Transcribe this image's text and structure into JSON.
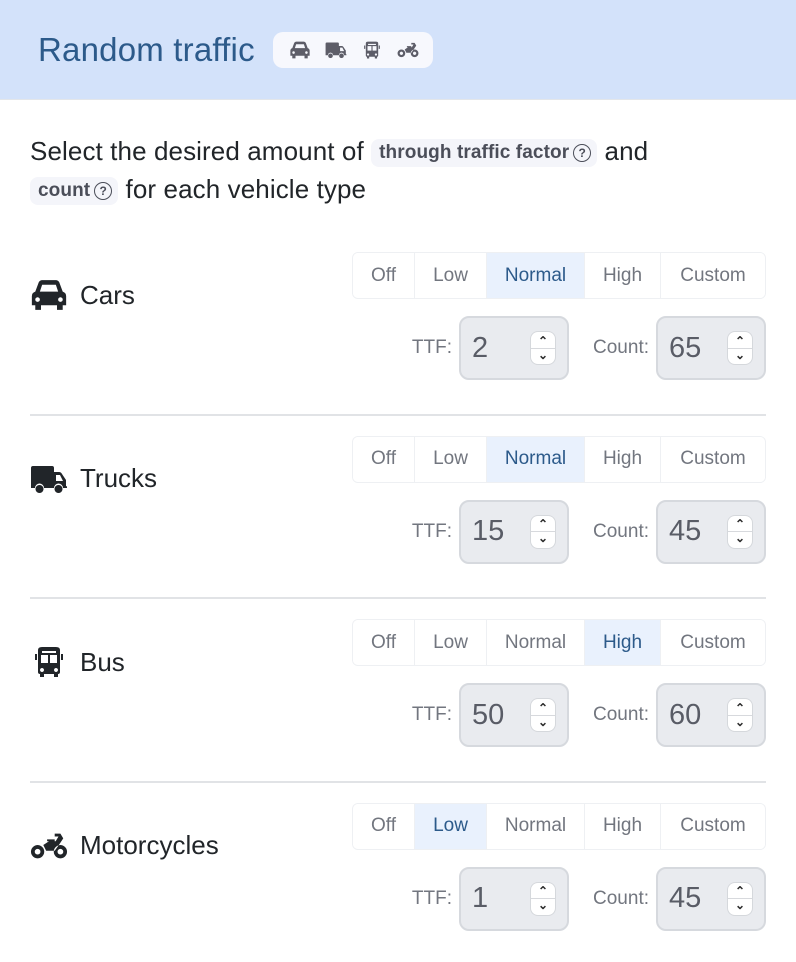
{
  "header": {
    "title": "Random traffic",
    "icons": [
      "car-icon",
      "truck-icon",
      "bus-icon",
      "motorcycle-icon"
    ]
  },
  "intro": {
    "text_before": "Select the desired amount of",
    "chip_ttf": "through traffic factor",
    "text_middle": "and",
    "chip_count": "count",
    "text_after": "for each vehicle type",
    "help_glyph": "?"
  },
  "levels": [
    "Off",
    "Low",
    "Normal",
    "High",
    "Custom"
  ],
  "labels": {
    "ttf": "TTF:",
    "count": "Count:"
  },
  "spinner": {
    "up": "⌃",
    "down": "⌄"
  },
  "vehicles": [
    {
      "name": "Cars",
      "icon": "car-icon",
      "selected": "Normal",
      "ttf": "2",
      "count": "65"
    },
    {
      "name": "Trucks",
      "icon": "truck-icon",
      "selected": "Normal",
      "ttf": "15",
      "count": "45"
    },
    {
      "name": "Bus",
      "icon": "bus-icon",
      "selected": "High",
      "ttf": "50",
      "count": "60"
    },
    {
      "name": "Motorcycles",
      "icon": "motorcycle-icon",
      "selected": "Low",
      "ttf": "1",
      "count": "45"
    }
  ],
  "colors": {
    "header_bg": "#d3e2fa",
    "title": "#2c5a8a",
    "active_segment_bg": "#e9f1fd",
    "active_segment_text": "#2c5a8a"
  }
}
